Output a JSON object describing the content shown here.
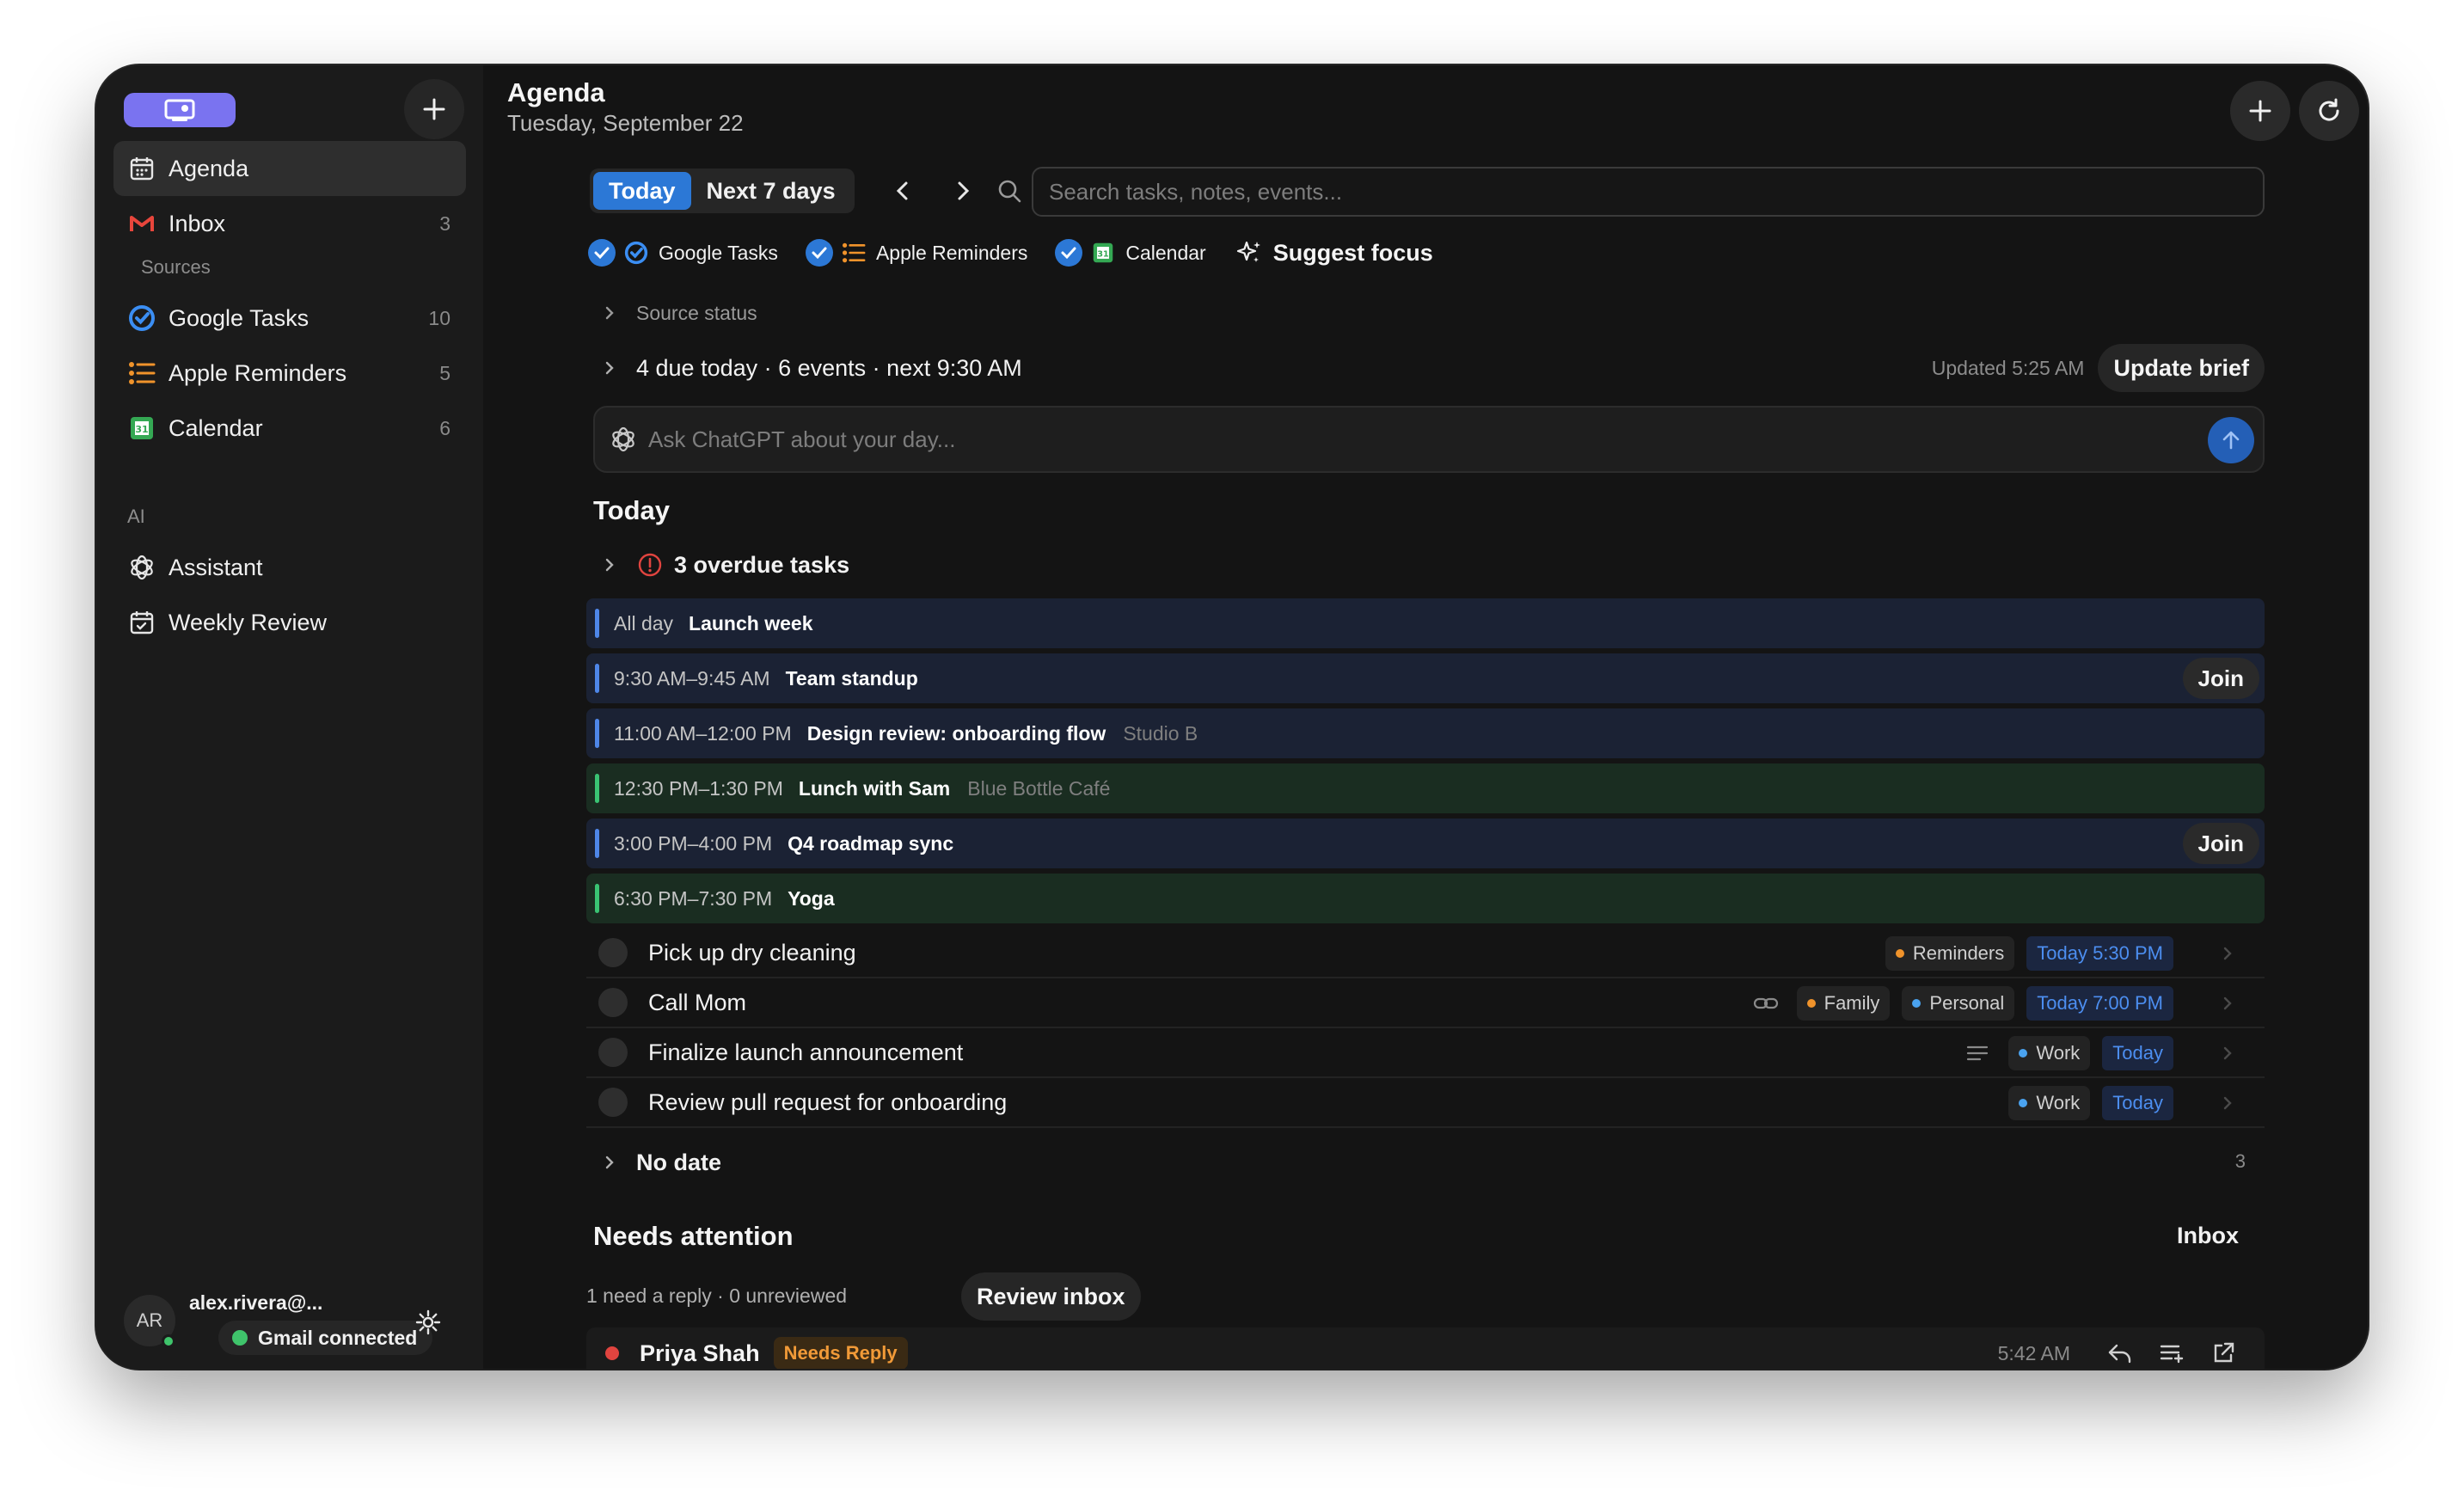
{
  "sidebar": {
    "nav": [
      {
        "label": "Agenda",
        "count": ""
      },
      {
        "label": "Inbox",
        "count": "3"
      }
    ],
    "sources_label": "Sources",
    "sources": [
      {
        "label": "Google Tasks",
        "count": "10"
      },
      {
        "label": "Apple Reminders",
        "count": "5"
      },
      {
        "label": "Calendar",
        "count": "6"
      }
    ],
    "ai_label": "AI",
    "ai": [
      {
        "label": "Assistant"
      },
      {
        "label": "Weekly Review"
      }
    ],
    "user": {
      "initials": "AR",
      "email": "alex.rivera@...",
      "gmail_status": "Gmail connected"
    }
  },
  "header": {
    "title": "Agenda",
    "date": "Tuesday, September 22"
  },
  "toolbar": {
    "range_options": [
      "Today",
      "Next 7 days"
    ],
    "selected_range": "Today",
    "search_placeholder": "Search tasks, notes, events...",
    "filters": [
      "Google Tasks",
      "Apple Reminders",
      "Calendar"
    ],
    "suggest_focus": "Suggest focus"
  },
  "source_status": "Source status",
  "brief": {
    "summary": "4 due today · 6 events · next 9:30 AM",
    "updated": "Updated 5:25 AM",
    "update_button": "Update brief"
  },
  "ask": {
    "placeholder": "Ask ChatGPT about your day..."
  },
  "today": {
    "heading": "Today",
    "overdue": "3 overdue tasks",
    "events": [
      {
        "time": "All day",
        "title": "Launch week",
        "location": "",
        "color": "blue",
        "join": ""
      },
      {
        "time": "9:30 AM–9:45 AM",
        "title": "Team standup",
        "location": "",
        "color": "blue",
        "join": "Join"
      },
      {
        "time": "11:00 AM–12:00 PM",
        "title": "Design review: onboarding flow",
        "location": "Studio B",
        "color": "blue",
        "join": ""
      },
      {
        "time": "12:30 PM–1:30 PM",
        "title": "Lunch with Sam",
        "location": "Blue Bottle Café",
        "color": "green",
        "join": ""
      },
      {
        "time": "3:00 PM–4:00 PM",
        "title": "Q4 roadmap sync",
        "location": "",
        "color": "blue",
        "join": "Join"
      },
      {
        "time": "6:30 PM–7:30 PM",
        "title": "Yoga",
        "location": "",
        "color": "green",
        "join": ""
      }
    ],
    "tasks": [
      {
        "title": "Pick up dry cleaning",
        "tags": [
          {
            "label": "Reminders",
            "color": "#f0932b"
          }
        ],
        "due": "Today 5:30 PM",
        "icon": ""
      },
      {
        "title": "Call Mom",
        "tags": [
          {
            "label": "Family",
            "color": "#f0932b"
          },
          {
            "label": "Personal",
            "color": "#4aa3f0"
          }
        ],
        "due": "Today 7:00 PM",
        "icon": "link-icon"
      },
      {
        "title": "Finalize launch announcement",
        "tags": [
          {
            "label": "Work",
            "color": "#4aa3f0"
          }
        ],
        "due": "Today",
        "icon": "notes-icon"
      },
      {
        "title": "Review pull request for onboarding",
        "tags": [
          {
            "label": "Work",
            "color": "#4aa3f0"
          }
        ],
        "due": "Today",
        "icon": ""
      }
    ]
  },
  "no_date": {
    "label": "No date",
    "count": "3"
  },
  "attention": {
    "heading": "Needs attention",
    "inbox_link": "Inbox",
    "summary": "1 need a reply · 0 unreviewed",
    "review_button": "Review inbox",
    "messages": [
      {
        "sender": "Priya Shah",
        "badge": "Needs Reply",
        "time": "5:42 AM"
      }
    ]
  },
  "colors": {
    "accent": "#2c78d6",
    "brand": "#7a73f0",
    "event_blue": "#4e86e8",
    "event_green": "#3ac373",
    "overdue": "#e0443f",
    "needs_reply": "#f19a38"
  }
}
